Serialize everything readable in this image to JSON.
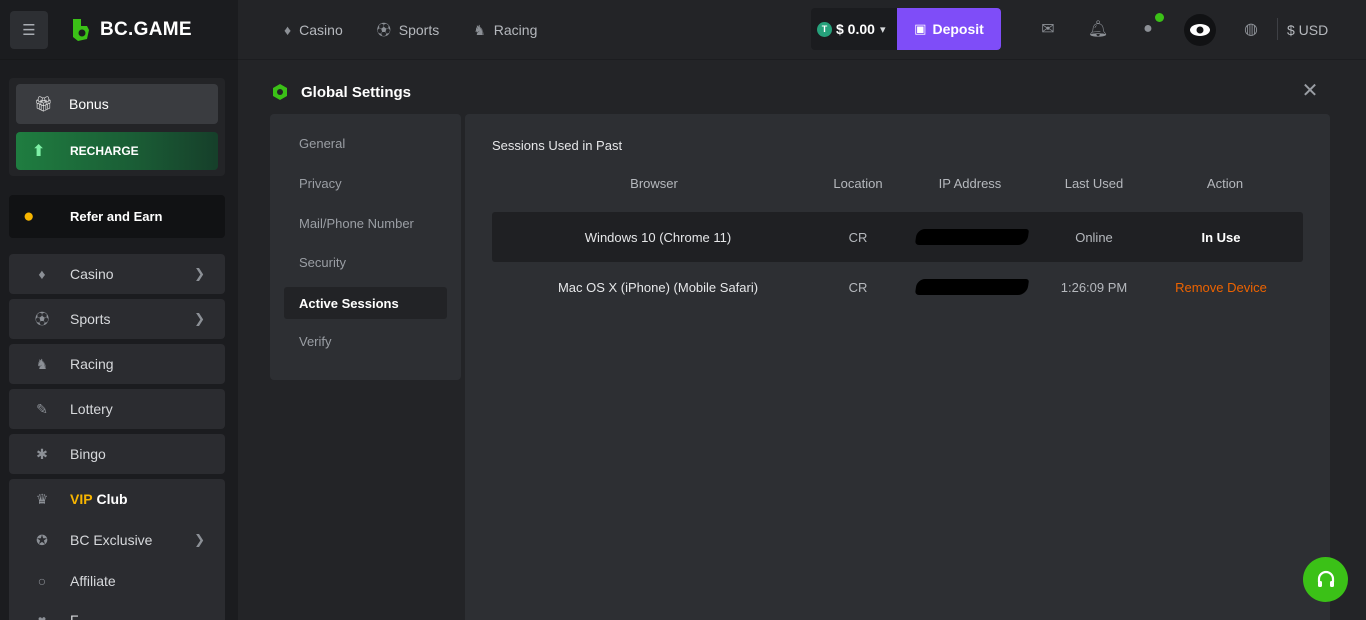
{
  "app": {
    "logo_text": "BC.GAME"
  },
  "sidebar": {
    "bonus_label": "Bonus",
    "recharge_label": "RECHARGE",
    "refer_label": "Refer and Earn",
    "items": [
      {
        "label": "Casino",
        "icon": "casino-icon"
      },
      {
        "label": "Sports",
        "icon": "sports-icon"
      },
      {
        "label": "Racing",
        "icon": "racing-icon"
      },
      {
        "label": "Lottery",
        "icon": "lottery-icon"
      },
      {
        "label": "Bingo",
        "icon": "bingo-icon"
      }
    ],
    "vip_word": "VIP",
    "vip_club": "Club",
    "bc_exclusive": "BC Exclusive",
    "affiliate": "Affiliate",
    "partial_item": "F"
  },
  "topbar": {
    "links": [
      "Casino",
      "Sports",
      "Racing"
    ],
    "balance": "$ 0.00",
    "tether_symbol": "T",
    "deposit_label": "Deposit",
    "currency": "$ USD"
  },
  "settings": {
    "title": "Global Settings",
    "nav": [
      "General",
      "Privacy",
      "Mail/Phone Number",
      "Security",
      "Active Sessions",
      "Verify"
    ],
    "active_nav": "Active Sessions"
  },
  "sessions": {
    "title": "Sessions Used in Past",
    "headers": [
      "Browser",
      "Location",
      "IP Address",
      "Last Used",
      "Action"
    ],
    "rows": [
      {
        "browser": "Windows 10 (Chrome 11)",
        "location": "CR",
        "ip": "[redacted]",
        "last_used": "Online",
        "action": "In Use"
      },
      {
        "browser": "Mac OS X (iPhone) (Mobile Safari)",
        "location": "CR",
        "ip": "[redacted]",
        "last_used": "1:26:09 PM",
        "action": "Remove Device"
      }
    ]
  },
  "colors": {
    "accent_green": "#3bc117",
    "deposit_purple": "#7f4df8",
    "remove_orange": "#ed6300",
    "vip_gold": "#f7b500",
    "background": "#232427"
  }
}
